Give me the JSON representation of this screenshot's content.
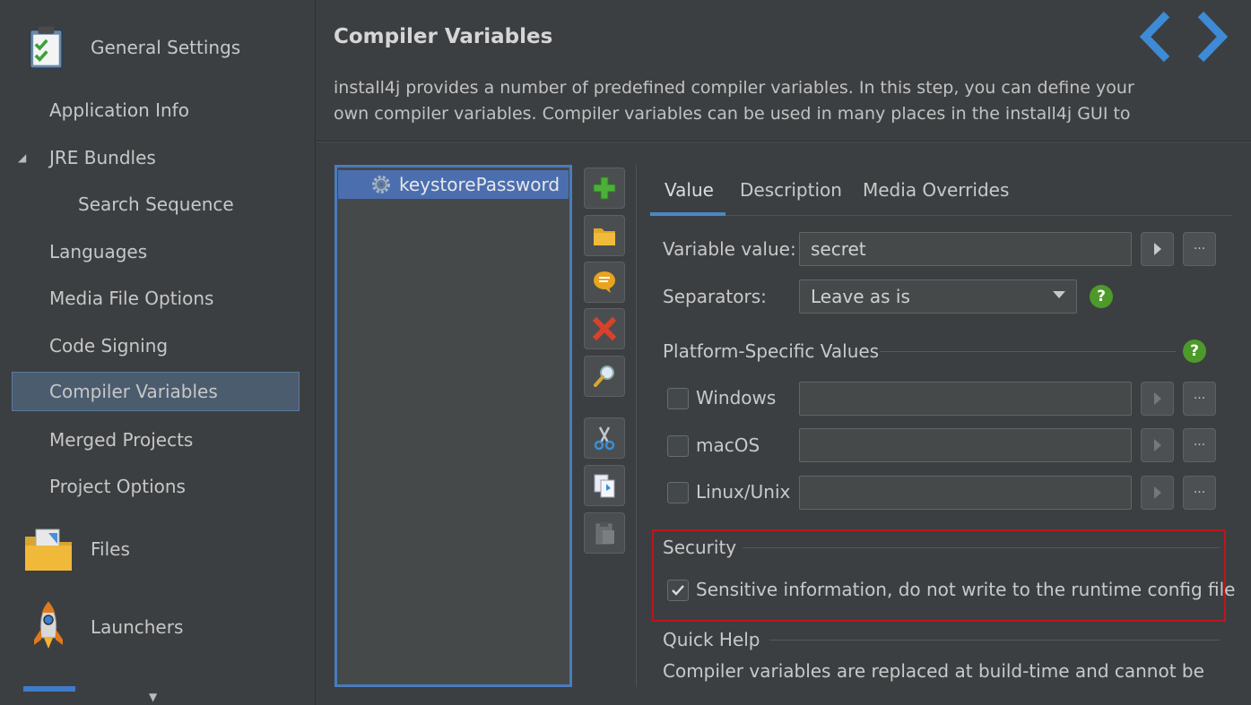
{
  "sidebar": {
    "general_settings": "General Settings",
    "items": [
      {
        "label": "Application Info"
      },
      {
        "label": "JRE Bundles"
      },
      {
        "label": "Search Sequence"
      },
      {
        "label": "Languages"
      },
      {
        "label": "Media File Options"
      },
      {
        "label": "Code Signing"
      },
      {
        "label": "Compiler Variables"
      },
      {
        "label": "Merged Projects"
      },
      {
        "label": "Project Options"
      }
    ],
    "files": "Files",
    "launchers": "Launchers"
  },
  "header": {
    "title": "Compiler Variables",
    "description_line1": "install4j provides a number of predefined compiler variables. In this step, you can define your",
    "description_line2": "own compiler variables. Compiler variables can be used in many places in the install4j GUI to"
  },
  "variable_list": [
    {
      "name": "keystorePassword"
    }
  ],
  "tabs": [
    {
      "label": "Value"
    },
    {
      "label": "Description"
    },
    {
      "label": "Media Overrides"
    }
  ],
  "form": {
    "variable_value_label": "Variable value:",
    "variable_value": "secret",
    "separators_label": "Separators:",
    "separators_value": "Leave as is",
    "platform_group": "Platform-Specific Values",
    "windows": "Windows",
    "macos": "macOS",
    "linux": "Linux/Unix",
    "dots": "···",
    "help": "?"
  },
  "security": {
    "title": "Security",
    "sensitive_label": "Sensitive information, do not write to the runtime config file",
    "sensitive_checked": true
  },
  "quick_help": {
    "title": "Quick Help",
    "text": "Compiler variables are replaced at build-time and cannot be"
  },
  "colors": {
    "accent": "#4a88c7",
    "selection": "#4b6eaf",
    "highlight_box": "#c0141c",
    "help_green": "#4d9a2a"
  }
}
